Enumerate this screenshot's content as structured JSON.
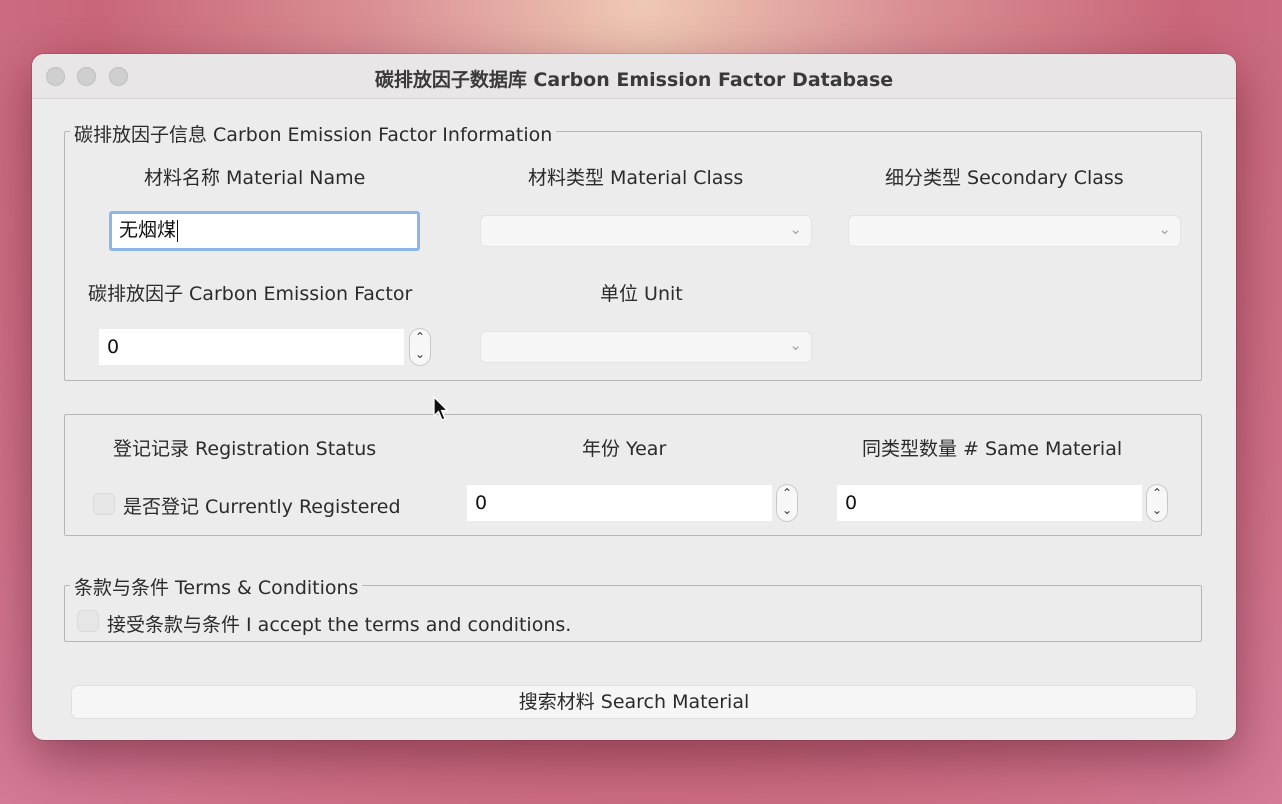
{
  "window": {
    "title": "碳排放因子数据库 Carbon Emission Factor Database"
  },
  "info_group": {
    "legend": "碳排放因子信息 Carbon Emission Factor Information",
    "material_name_label": "材料名称 Material Name",
    "material_name_value": "无烟煤",
    "material_class_label": "材料类型 Material Class",
    "material_class_value": "",
    "secondary_class_label": "细分类型 Secondary Class",
    "secondary_class_value": "",
    "emission_factor_label": "碳排放因子 Carbon Emission Factor",
    "emission_factor_value": "0",
    "unit_label": "单位 Unit",
    "unit_value": ""
  },
  "registration_group": {
    "status_label": "登记记录 Registration Status",
    "registered_checkbox_label": "是否登记 Currently Registered",
    "year_label": "年份 Year",
    "year_value": "0",
    "same_material_label": "同类型数量 # Same Material",
    "same_material_value": "0"
  },
  "terms_group": {
    "legend": "条款与条件 Terms & Conditions",
    "accept_label": "接受条款与条件 I accept the terms and conditions."
  },
  "search_button": {
    "label": "搜索材料 Search Material"
  },
  "icons": {
    "chevron": "chevron-down-icon",
    "stepper": "stepper-up-down-icon",
    "cursor": "mouse-pointer-icon"
  }
}
